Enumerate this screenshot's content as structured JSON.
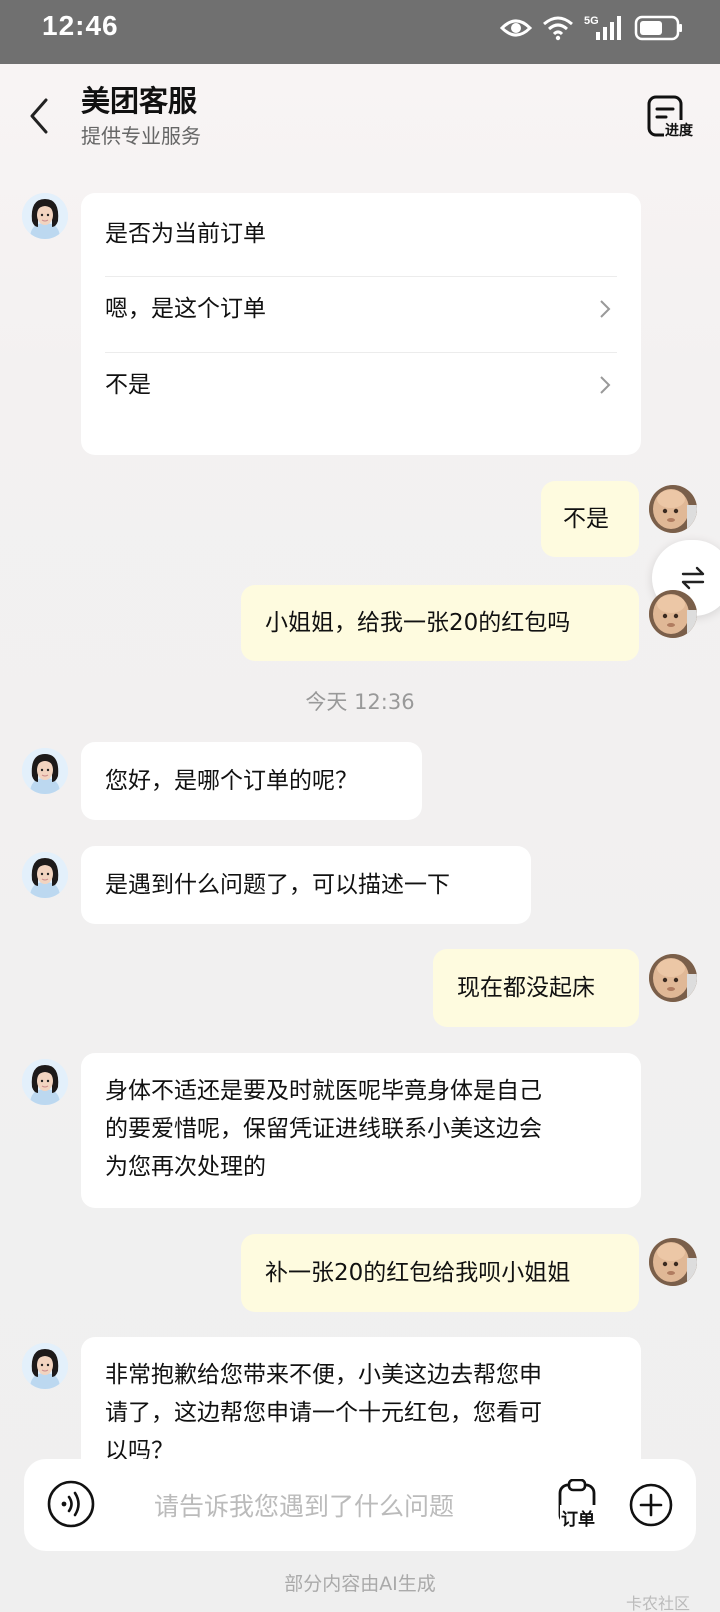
{
  "status_bar": {
    "time": "12:46",
    "network": "5G"
  },
  "header": {
    "title": "美团客服",
    "subtitle": "提供专业服务",
    "progress_label": "进度"
  },
  "order_card": {
    "question": "是否为当前订单",
    "options": [
      "嗯，是这个订单",
      "不是"
    ]
  },
  "messages": [
    {
      "from": "user",
      "text": "不是"
    },
    {
      "from": "user",
      "text": "小姐姐，给我一张20的红包吗"
    },
    {
      "from": "cs",
      "text": "您好，是哪个订单的呢？"
    },
    {
      "from": "cs",
      "text": "是遇到什么问题了，可以描述一下"
    },
    {
      "from": "user",
      "text": "现在都没起床"
    },
    {
      "from": "cs",
      "lines": [
        "身体不适还是要及时就医呢毕竟身体是自己",
        "的要爱惜呢，保留凭证进线联系小美这边会",
        "为您再次处理的"
      ]
    },
    {
      "from": "user",
      "text": "补一张20的红包给我呗小姐姐"
    },
    {
      "from": "cs",
      "lines": [
        "非常抱歉给您带来不便，小美这边去帮您申",
        "请了，这边帮您申请一个十元红包，您看可",
        "以吗？"
      ]
    }
  ],
  "timestamp": "今天 12:36",
  "input_bar": {
    "placeholder": "请告诉我您遇到了什么问题",
    "order_label": "订单"
  },
  "footer": {
    "ai_note": "部分内容由AI生成",
    "watermark": "卡农社区"
  },
  "colors": {
    "user_bubble": "#fefbdf",
    "cs_bubble": "#ffffff",
    "status_bar": "#707070"
  }
}
